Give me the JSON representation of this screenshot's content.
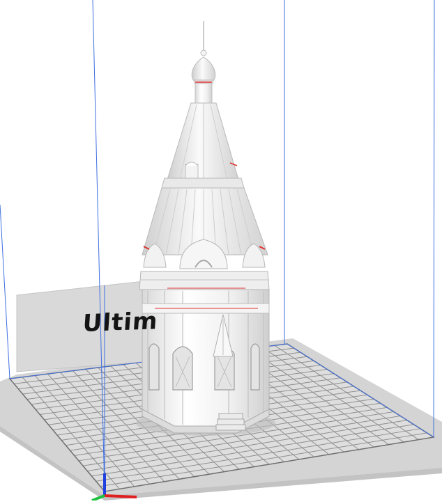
{
  "viewport": {
    "brand_label": "Ultim",
    "colors": {
      "background": "#ffffff",
      "build_plate": "#c9c9c9",
      "grid_line": "#8d8d8d",
      "volume_edge": "#3f6fe0",
      "model": "#f2f2f2",
      "model_shadow": "#c8c8c8",
      "overhang_marker": "#e03030",
      "axis_x": "#e02020",
      "axis_y": "#20c040",
      "axis_z": "#2040e0"
    }
  }
}
